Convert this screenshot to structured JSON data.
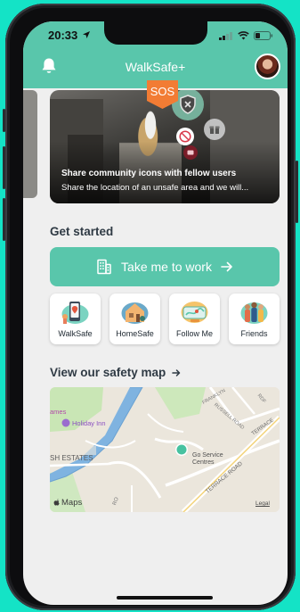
{
  "status_bar": {
    "time": "20:33"
  },
  "app": {
    "title": "WalkSafe+"
  },
  "carousel": {
    "badge": "SOS",
    "card_title": "Share community icons with fellow users",
    "card_description": "Share the location of an unsafe area and we will..."
  },
  "get_started": {
    "heading": "Get started",
    "cta_label": "Take me to work",
    "tiles": [
      {
        "label": "WalkSafe"
      },
      {
        "label": "HomeSafe"
      },
      {
        "label": "Follow Me"
      },
      {
        "label": "Friends"
      }
    ]
  },
  "safety_map": {
    "heading": "View our safety map",
    "labels": {
      "partial_left": "ames",
      "hotel": "Holiday Inn",
      "estates": "SH ESTATES",
      "service": "Go Service Centres",
      "franklyn": "FRANKLYN",
      "russell": "RUSSELL ROAD",
      "terrace_road": "TERRACE ROAD",
      "terrace": "TERRACE",
      "rdf": "RDF",
      "ro": "RO",
      "maps": "Maps",
      "legal": "Legal"
    }
  },
  "colors": {
    "accent": "#59c6ab",
    "sos": "#f27c34",
    "background": "#14e3c6"
  }
}
